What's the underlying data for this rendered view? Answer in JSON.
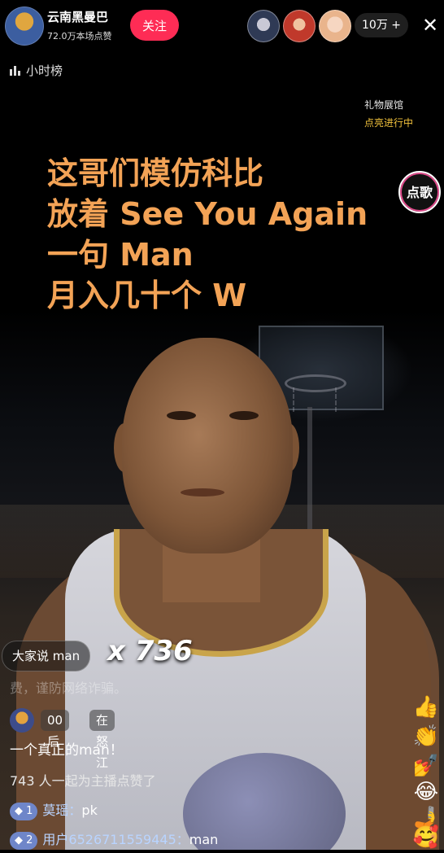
{
  "header": {
    "anchor_name": "云南黑曼巴",
    "anchor_likes": "72.0万本场点赞",
    "follow_label": "关注",
    "viewer_count": "10万 +",
    "close_glyph": "✕"
  },
  "rank": {
    "label": "小时榜"
  },
  "gift": {
    "hall": "礼物展馆",
    "status": "点亮进行中"
  },
  "song_button": "点歌",
  "caption": {
    "line1": "这哥们模仿科比",
    "line2": "放着 See You Again",
    "line3": "一句 Man",
    "line4": "月入几十个 W"
  },
  "combo": {
    "label": "大家说  man",
    "count": "x 736"
  },
  "chat": {
    "notice": "费，谨防网络诈骗。",
    "join_badge1": "00后",
    "join_badge2": "在怒江",
    "message": "一个真正的man！",
    "likes": "743 人一起为主播点赞了",
    "users": [
      {
        "level": "◆ 1",
        "name": "莫瑶：",
        "text": "pk"
      },
      {
        "level": "◆ 2",
        "name": "用户6526711559445：",
        "text": "man"
      }
    ]
  },
  "emojis": [
    "👍",
    "👏",
    "💅",
    "😂",
    "🤳",
    "🥰"
  ],
  "colors": {
    "follow": "#fe2c55",
    "caption": "#f3a356",
    "gift_status": "#f2c23c"
  }
}
